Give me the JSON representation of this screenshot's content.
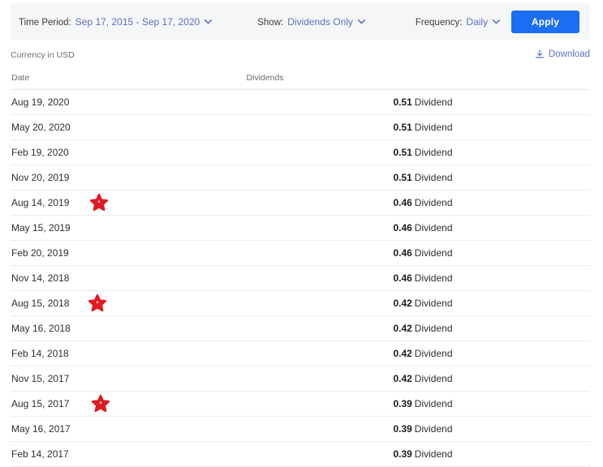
{
  "filters": {
    "time_period": {
      "label": "Time Period:",
      "value": "Sep 17, 2015 - Sep 17, 2020"
    },
    "show": {
      "label": "Show:",
      "value": "Dividends Only"
    },
    "frequency": {
      "label": "Frequency:",
      "value": "Daily"
    },
    "apply_label": "Apply"
  },
  "meta": {
    "currency_note": "Currency in USD",
    "download_label": "Download",
    "download_icon": "download-icon"
  },
  "table": {
    "columns": [
      "Date",
      "Dividends"
    ],
    "value_suffix": "Dividend",
    "star_color": "#e01b24",
    "rows": [
      {
        "date": "Aug 19, 2020",
        "amount": "0.51",
        "type": "Dividend",
        "star": false
      },
      {
        "date": "May 20, 2020",
        "amount": "0.51",
        "type": "Dividend",
        "star": false
      },
      {
        "date": "Feb 19, 2020",
        "amount": "0.51",
        "type": "Dividend",
        "star": false
      },
      {
        "date": "Nov 20, 2019",
        "amount": "0.51",
        "type": "Dividend",
        "star": false
      },
      {
        "date": "Aug 14, 2019",
        "amount": "0.46",
        "type": "Dividend",
        "star": true
      },
      {
        "date": "May 15, 2019",
        "amount": "0.46",
        "type": "Dividend",
        "star": false
      },
      {
        "date": "Feb 20, 2019",
        "amount": "0.46",
        "type": "Dividend",
        "star": false
      },
      {
        "date": "Nov 14, 2018",
        "amount": "0.46",
        "type": "Dividend",
        "star": false
      },
      {
        "date": "Aug 15, 2018",
        "amount": "0.42",
        "type": "Dividend",
        "star": true
      },
      {
        "date": "May 16, 2018",
        "amount": "0.42",
        "type": "Dividend",
        "star": false
      },
      {
        "date": "Feb 14, 2018",
        "amount": "0.42",
        "type": "Dividend",
        "star": false
      },
      {
        "date": "Nov 15, 2017",
        "amount": "0.42",
        "type": "Dividend",
        "star": false
      },
      {
        "date": "Aug 15, 2017",
        "amount": "0.39",
        "type": "Dividend",
        "star": true
      },
      {
        "date": "May 16, 2017",
        "amount": "0.39",
        "type": "Dividend",
        "star": false
      },
      {
        "date": "Feb 14, 2017",
        "amount": "0.39",
        "type": "Dividend",
        "star": false
      }
    ]
  }
}
